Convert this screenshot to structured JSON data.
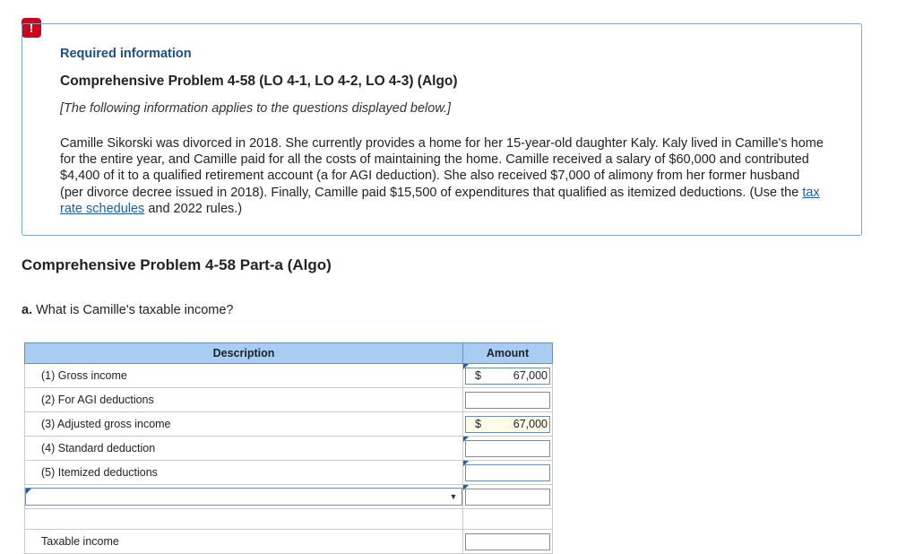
{
  "alert": {
    "glyph": "!"
  },
  "info": {
    "heading": "Required information",
    "problem_title": "Comprehensive Problem 4-58 (LO 4-1, LO 4-2, LO 4-3) (Algo)",
    "applies": "[The following information applies to the questions displayed below.]",
    "body_before_link": "Camille Sikorski was divorced in 2018. She currently provides a home for her 15-year-old daughter Kaly. Kaly lived in Camille's home for the entire year, and Camille paid for all the costs of maintaining the home. Camille received a salary of $60,000 and contributed $4,400 of it to a qualified retirement account (a for AGI deduction). She also received $7,000 of alimony from her former husband (per divorce decree issued in 2018). Finally, Camille paid $15,500 of expenditures that qualified as itemized deductions. (Use the ",
    "link_text": "tax rate schedules",
    "body_after_link": " and 2022 rules.)"
  },
  "part": {
    "title": "Comprehensive Problem 4-58 Part-a (Algo)",
    "question_label": "a.",
    "question_text": " What is Camille's taxable income?"
  },
  "table": {
    "headers": {
      "description": "Description",
      "amount": "Amount"
    },
    "rows": [
      {
        "label": "(1) Gross income",
        "dollar": "$",
        "value": "67,000"
      },
      {
        "label": "(2) For AGI deductions",
        "dollar": "",
        "value": ""
      },
      {
        "label": "(3) Adjusted gross income",
        "dollar": "$",
        "value": "67,000"
      },
      {
        "label": "(4) Standard deduction",
        "dollar": "",
        "value": ""
      },
      {
        "label": "(5) Itemized deductions",
        "dollar": "",
        "value": ""
      }
    ],
    "select_value": "",
    "final_label": "Taxable income",
    "final_value": ""
  }
}
